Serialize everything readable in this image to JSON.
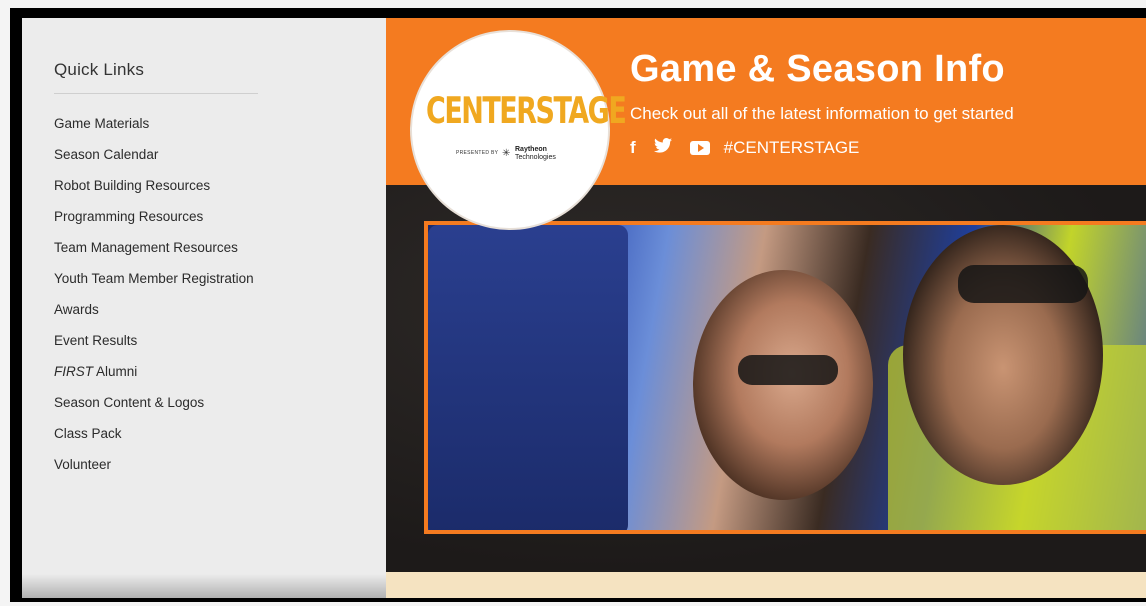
{
  "sidebar": {
    "title": "Quick Links",
    "items": [
      {
        "label": "Game Materials"
      },
      {
        "label": "Season Calendar"
      },
      {
        "label": "Robot Building Resources"
      },
      {
        "label": "Programming Resources"
      },
      {
        "label": "Team Management Resources"
      },
      {
        "label": "Youth Team Member Registration"
      },
      {
        "label": "Awards"
      },
      {
        "label": "Event Results"
      },
      {
        "label_italic": "FIRST",
        "label_rest": " Alumni"
      },
      {
        "label": "Season Content & Logos"
      },
      {
        "label": "Class Pack"
      },
      {
        "label": "Volunteer"
      }
    ]
  },
  "banner": {
    "title": "Game & Season Info",
    "subtitle": "Check out all of the latest information to get started",
    "hashtag": "#CENTERSTAGE",
    "social_icons": [
      "facebook-icon",
      "twitter-icon",
      "youtube-icon"
    ],
    "color": "#f47b20"
  },
  "logo": {
    "wordmark": "CENTERSTAGE",
    "presented_by": "PRESENTED BY",
    "sponsor_name": "Raytheon",
    "sponsor_sub": "Technologies"
  }
}
